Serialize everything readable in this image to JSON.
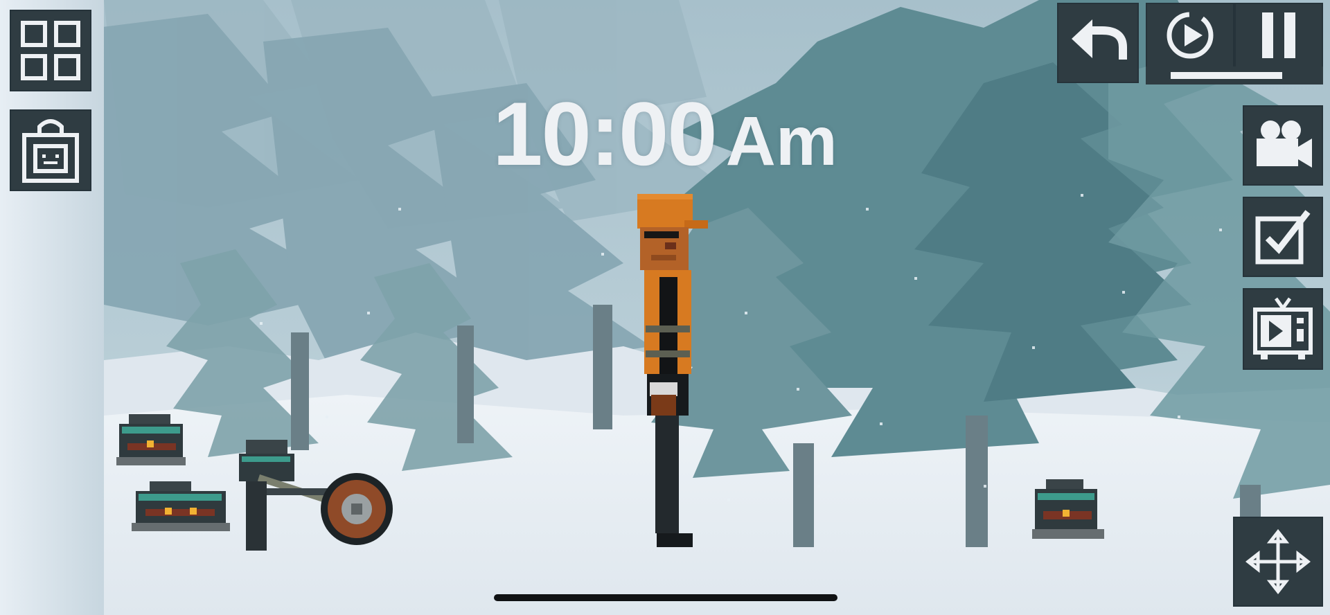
{
  "clock": {
    "time": "10:00",
    "period": "Am"
  },
  "toolbar_left": [
    {
      "name": "catalog-button",
      "icon": "grid-icon"
    },
    {
      "name": "shop-button",
      "icon": "shopping-bag-icon"
    }
  ],
  "toolbar_top_right": [
    {
      "name": "undo-button",
      "icon": "undo-arrow-icon"
    },
    {
      "name": "slow-motion-button",
      "icon": "slow-motion-timer-icon"
    },
    {
      "name": "pause-button",
      "icon": "pause-icon"
    }
  ],
  "toolbar_right": [
    {
      "name": "camera-button",
      "icon": "video-camera-icon"
    },
    {
      "name": "select-button",
      "icon": "checkbox-icon"
    },
    {
      "name": "tv-button",
      "icon": "tv-icon"
    },
    {
      "name": "move-button",
      "icon": "move-arrows-icon"
    }
  ],
  "time_scale_level": 0.82,
  "colors": {
    "button_bg": "#2f3c42",
    "button_icon": "#eef1f4",
    "sky": "#a9c2cd",
    "trees": "#5e8b93",
    "snow": "#e4ebf1",
    "helmet_orange": "#d77a21"
  }
}
